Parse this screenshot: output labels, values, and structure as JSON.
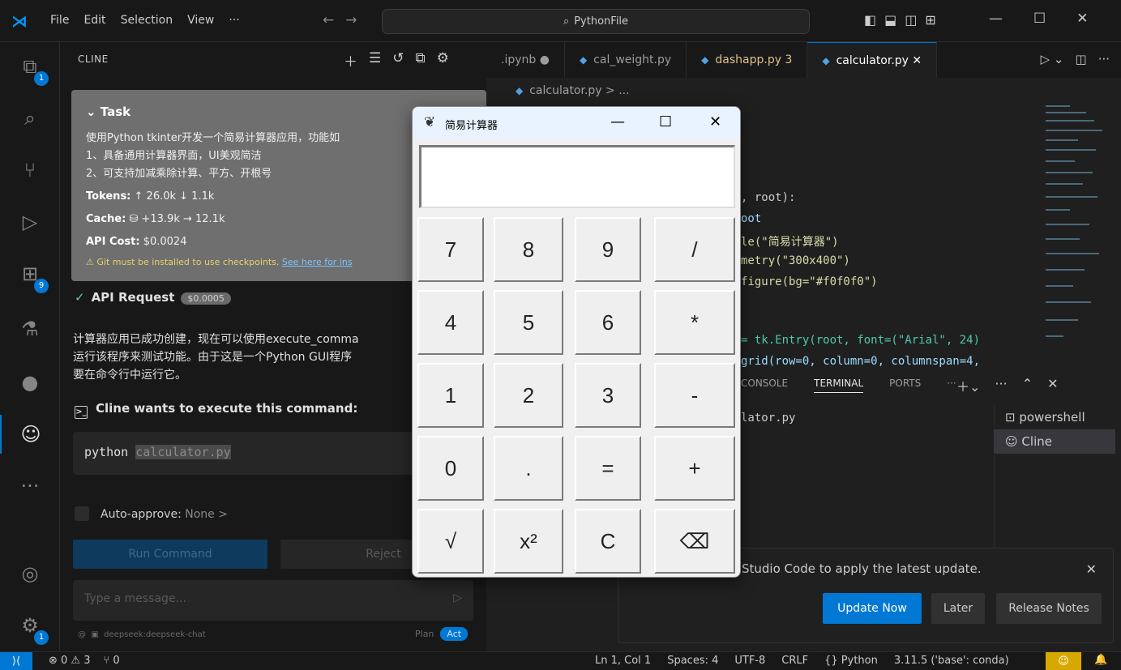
{
  "titlebar": {
    "menu": [
      "File",
      "Edit",
      "Selection",
      "View",
      "···"
    ],
    "search": "PythonFile",
    "window_controls": [
      "—",
      "☐",
      "✕"
    ]
  },
  "activity": {
    "explorer_badge": "1",
    "extensions_badge": "9",
    "more": "···",
    "settings_badge": "1"
  },
  "sidebar": {
    "title": "CLINE",
    "task": {
      "title": "Task",
      "lines": [
        "使用Python tkinter开发一个简易计算器应用，功能如",
        "1、具备通用计算器界面，UI美观简洁",
        "2、可支持加减乘除计算、平方、开根号"
      ],
      "tokens_label": "Tokens:",
      "tokens_value": "↑ 26.0k ↓ 1.1k",
      "cache_label": "Cache:",
      "cache_value": "+13.9k → 12.1k",
      "cost_label": "API Cost:",
      "cost_value": "$0.0024",
      "warning": "Git must be installed to use checkpoints.",
      "warning_link": "See here for ins"
    },
    "api_request": {
      "label": "API Request",
      "cost": "$0.0005"
    },
    "message_lines": [
      "计算器应用已成功创建，现在可以使用execute_comma",
      "运行该程序来测试功能。由于这是一个Python GUI程序",
      "要在命令行中运行它。"
    ],
    "command_title": "Cline wants to execute this command:",
    "command": {
      "prefix": "python ",
      "arg": "calculator.py"
    },
    "auto_approve": {
      "label": "Auto-approve:",
      "value": "None >"
    },
    "run_button": "Run Command",
    "reject_button": "Reject",
    "input_placeholder": "Type a message...",
    "model": "deepseek:deepseek-chat",
    "mode_plan": "Plan",
    "mode_act": "Act"
  },
  "editor": {
    "tabs": [
      {
        "label": ".ipynb ●",
        "state": "normal"
      },
      {
        "label": "cal_weight.py",
        "state": "normal"
      },
      {
        "label": "dashapp.py 3",
        "state": "err"
      },
      {
        "label": "calculator.py ✕",
        "state": "active"
      }
    ],
    "breadcrumb": "calculator.py > ...",
    "code_lines": [
      ", root):",
      "oot",
      "le(\"简易计算器\")",
      "metry(\"300x400\")",
      "figure(bg=\"#f0f0f0\")",
      "",
      "",
      "= tk.Entry(root, font=(\"Arial\", 24)",
      "grid(row=0, column=0, columnspan=4,"
    ]
  },
  "panel": {
    "tabs": [
      "CONSOLE",
      "TERMINAL",
      "PORTS"
    ],
    "terminal_text": "lator.py",
    "terminals": [
      "powershell",
      "Cline"
    ]
  },
  "notification": {
    "text": "Studio Code to apply the latest update.",
    "update_now": "Update Now",
    "later": "Later",
    "release_notes": "Release Notes"
  },
  "statusbar": {
    "problems": "⊗ 0 ⚠ 3",
    "ports": "⑂ 0",
    "position": "Ln 1, Col 1",
    "spaces": "Spaces: 4",
    "encoding": "UTF-8",
    "eol": "CRLF",
    "language": "{} Python",
    "interpreter": "3.11.5 ('base': conda)"
  },
  "calculator": {
    "title": "简易计算器",
    "display": "",
    "keys": [
      [
        "7",
        "8",
        "9",
        "/"
      ],
      [
        "4",
        "5",
        "6",
        "*"
      ],
      [
        "1",
        "2",
        "3",
        "-"
      ],
      [
        "0",
        ".",
        "=",
        "+"
      ],
      [
        "√",
        "x²",
        "C",
        "⌫"
      ]
    ]
  }
}
